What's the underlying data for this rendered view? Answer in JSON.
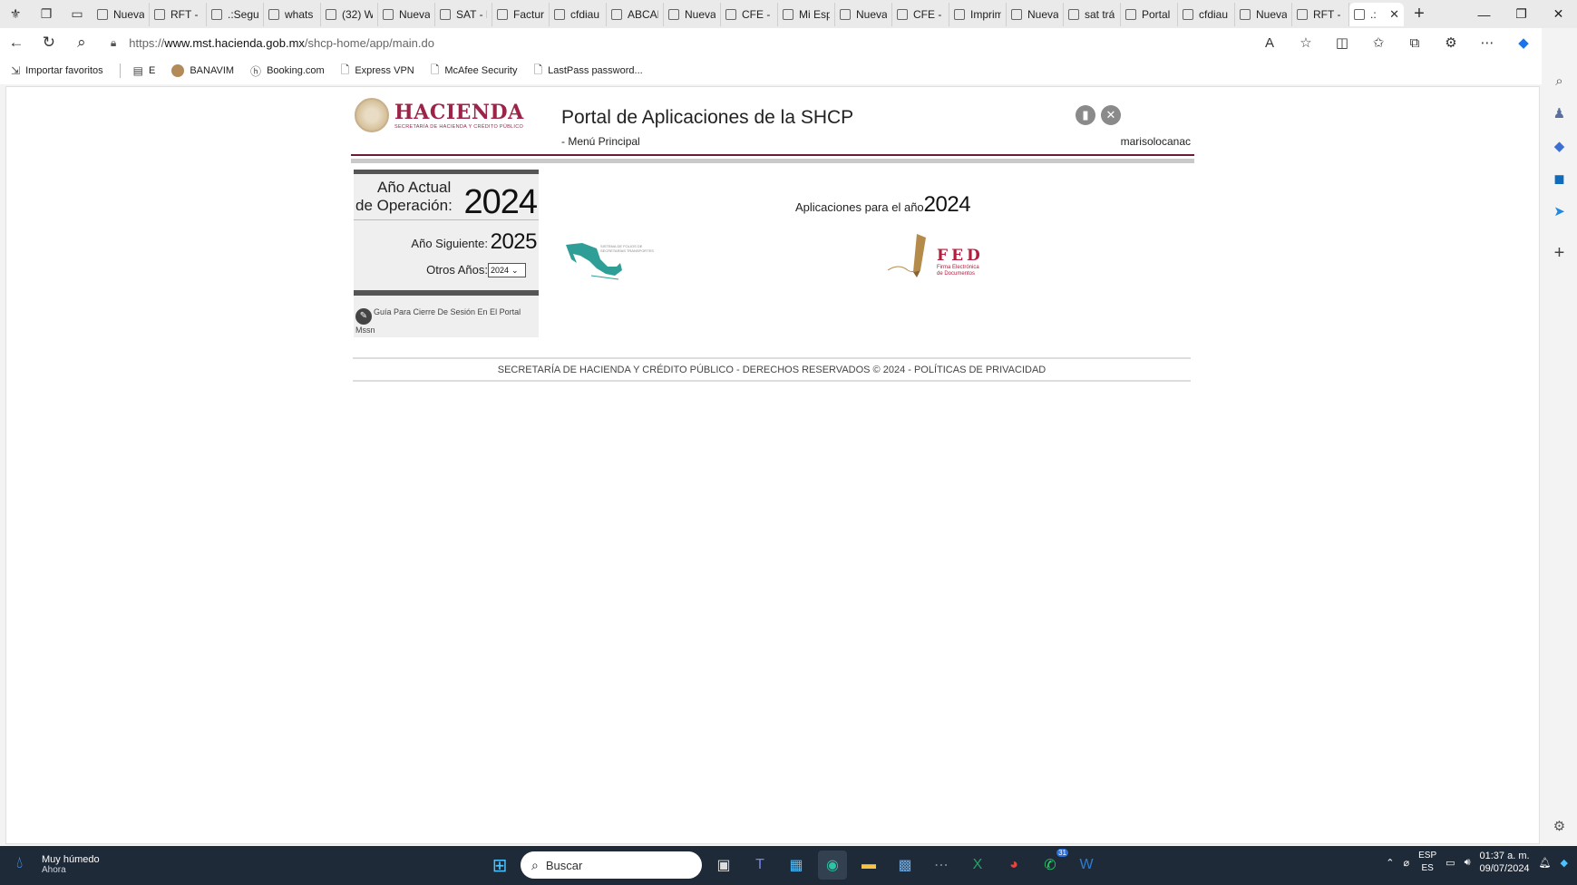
{
  "browser": {
    "tabs": [
      {
        "label": "Nueva",
        "icon": "page-icon"
      },
      {
        "label": "RFT - E",
        "icon": "bing-icon"
      },
      {
        "label": ".:Segui",
        "icon": "page-icon"
      },
      {
        "label": "whats",
        "icon": "bing-icon"
      },
      {
        "label": "(32) W",
        "icon": "whatsapp-icon"
      },
      {
        "label": "Nueva",
        "icon": "page-icon"
      },
      {
        "label": "SAT - E",
        "icon": "bing-icon"
      },
      {
        "label": "Factur",
        "icon": "grid-icon"
      },
      {
        "label": "cfdiau",
        "icon": "page-icon"
      },
      {
        "label": "ABCAD",
        "icon": "pdf-icon"
      },
      {
        "label": "Nueva",
        "icon": "newtab-icon"
      },
      {
        "label": "CFE - E",
        "icon": "search-icon"
      },
      {
        "label": "Mi Esp",
        "icon": "cfe-icon"
      },
      {
        "label": "Nueva",
        "icon": "newtab-icon"
      },
      {
        "label": "CFE - E",
        "icon": "search-icon"
      },
      {
        "label": "Imprim",
        "icon": "circle-icon"
      },
      {
        "label": "Nueva",
        "icon": "newtab-icon"
      },
      {
        "label": "sat trá",
        "icon": "search-icon"
      },
      {
        "label": "Portal",
        "icon": "grid-icon"
      },
      {
        "label": "cfdiau",
        "icon": "page-icon"
      },
      {
        "label": "Nueva",
        "icon": "newtab-icon"
      },
      {
        "label": "RFT - E",
        "icon": "search-icon"
      }
    ],
    "active_tab": {
      "label": ".:",
      "icon": "page-icon"
    },
    "url_prefix": "https://",
    "url_host": "www.mst.hacienda.gob.mx",
    "url_path": "/shcp-home/app/main.do",
    "favorites": [
      {
        "label": "Importar favoritos",
        "icon": "import-icon"
      },
      {
        "label": "E",
        "icon": "newtab-icon"
      },
      {
        "label": "BANAVIM",
        "icon": "circle-icon"
      },
      {
        "label": "Booking.com",
        "icon": "hp-icon"
      },
      {
        "label": "Express VPN",
        "icon": "page-icon"
      },
      {
        "label": "McAfee Security",
        "icon": "page-icon"
      },
      {
        "label": "LastPass password...",
        "icon": "page-icon"
      }
    ]
  },
  "page": {
    "logo_main": "HACIENDA",
    "logo_sub": "SECRETARÍA DE HACIENDA Y CRÉDITO PÚBLICO",
    "portal_title": "Portal de Aplicaciones de la SHCP",
    "menu_crumb": "- Menú Principal",
    "username": "marisolocanac",
    "current_year_label_1": "Año Actual",
    "current_year_label_2": "de Operación:",
    "current_year": "2024",
    "next_year_label": "Año Siguiente:",
    "next_year": "2025",
    "other_years_label": "Otros Años:",
    "other_years_selected": "2024",
    "guide_text": "Guía Para Cierre De Sesión En El Portal Mssn",
    "apps_heading_label": "Aplicaciones para el año",
    "apps_heading_year": "2024",
    "app_map_caption_1": "SISTEMA DE FOLIOS DE",
    "app_map_caption_2": "SECRETARÍAS TRANSPORTES",
    "fed_title": "FED",
    "fed_sub_1": "Firma Electrónica",
    "fed_sub_2": "de Documentos",
    "footer_text": "SECRETARÍA DE HACIENDA Y CRÉDITO PÚBLICO - DERECHOS RESERVADOS © 2024 - POLÍTICAS DE PRIVACIDAD"
  },
  "taskbar": {
    "weather_title": "Muy húmedo",
    "weather_sub": "Ahora",
    "search_placeholder": "Buscar",
    "lang_1": "ESP",
    "lang_2": "ES",
    "time": "01:37 a. m.",
    "date": "09/07/2024",
    "whatsapp_badge": "31"
  },
  "colors": {
    "hacienda_red": "#9d2449",
    "fed_red": "#b01f3e",
    "map_teal": "#2e9e96"
  }
}
